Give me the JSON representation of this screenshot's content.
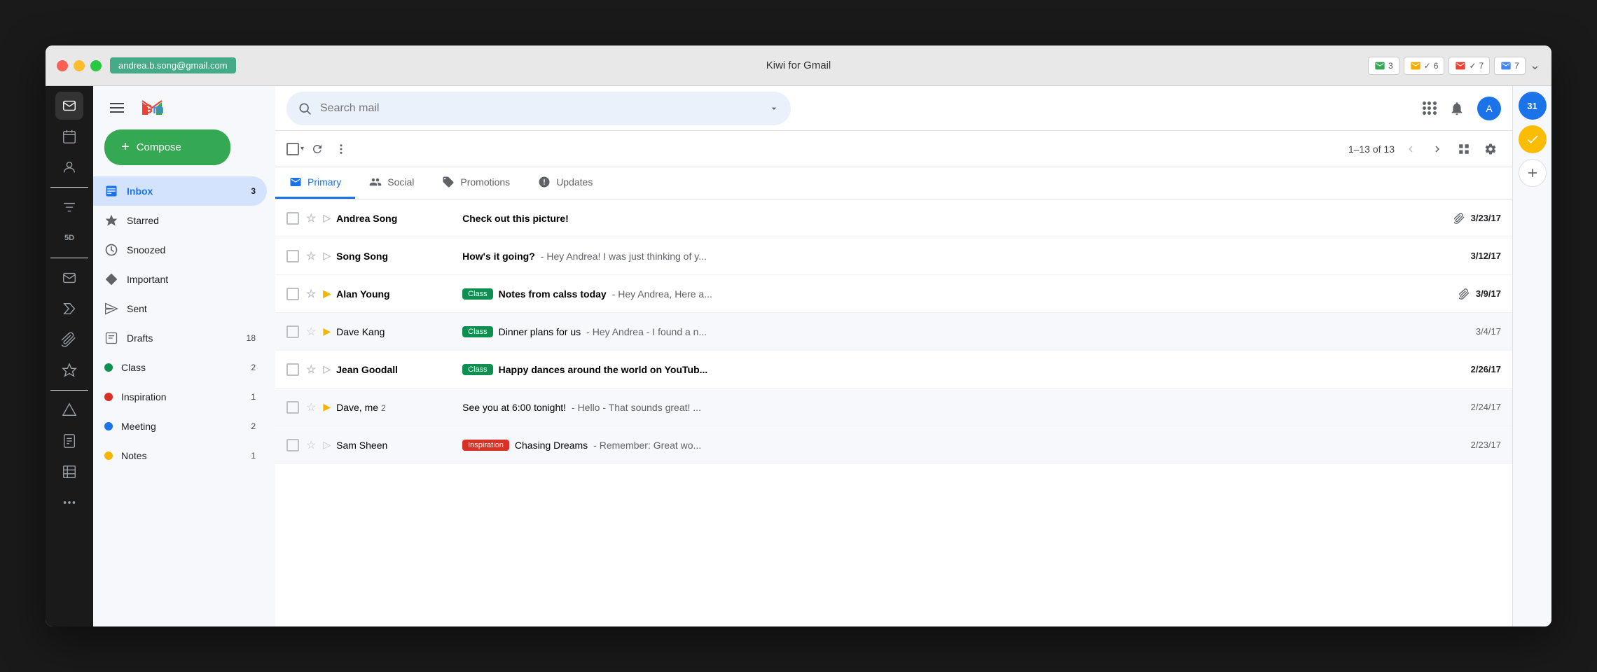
{
  "window": {
    "title": "Kiwi for Gmail",
    "account_email": "andrea.b.song@gmail.com"
  },
  "titlebar": {
    "notifications": [
      {
        "icon": "mail",
        "count": "3",
        "checked": false
      },
      {
        "icon": "mail",
        "count": "6",
        "checked": true
      },
      {
        "icon": "mail-red",
        "count": "7",
        "checked": false
      }
    ]
  },
  "header": {
    "search_placeholder": "Search mail",
    "gmail_logo": "Gmail"
  },
  "toolbar": {
    "counter": "1–13 of 13"
  },
  "tabs": [
    {
      "id": "primary",
      "label": "Primary",
      "active": true
    },
    {
      "id": "social",
      "label": "Social",
      "active": false
    },
    {
      "id": "promotions",
      "label": "Promotions",
      "active": false
    },
    {
      "id": "updates",
      "label": "Updates",
      "active": false
    }
  ],
  "sidebar": {
    "compose_label": "Compose",
    "items": [
      {
        "id": "inbox",
        "label": "Inbox",
        "count": 3,
        "icon": "inbox",
        "active": true
      },
      {
        "id": "starred",
        "label": "Starred",
        "count": null,
        "icon": "star"
      },
      {
        "id": "snoozed",
        "label": "Snoozed",
        "count": null,
        "icon": "clock"
      },
      {
        "id": "important",
        "label": "Important",
        "count": null,
        "icon": "important"
      },
      {
        "id": "sent",
        "label": "Sent",
        "count": null,
        "icon": "sent"
      },
      {
        "id": "drafts",
        "label": "Drafts",
        "count": 18,
        "icon": "draft"
      },
      {
        "id": "class",
        "label": "Class",
        "count": 2,
        "icon": "label",
        "color": "#0d904f"
      },
      {
        "id": "inspiration",
        "label": "Inspiration",
        "count": 1,
        "icon": "label",
        "color": "#d93025"
      },
      {
        "id": "meeting",
        "label": "Meeting",
        "count": 2,
        "icon": "label",
        "color": "#1a73e8"
      },
      {
        "id": "notes",
        "label": "Notes",
        "count": 1,
        "icon": "label",
        "color": "#f4b400"
      }
    ]
  },
  "emails": [
    {
      "id": 1,
      "sender": "Andrea Song",
      "subject": "Check out this picture!",
      "preview": "",
      "date": "3/23/17",
      "unread": true,
      "starred": false,
      "forwarded": false,
      "has_attachment": true,
      "tag": null
    },
    {
      "id": 2,
      "sender": "Song Song",
      "subject": "How's it going?",
      "preview": "- Hey Andrea! I was just thinking of y...",
      "date": "3/12/17",
      "unread": true,
      "starred": false,
      "forwarded": false,
      "has_attachment": false,
      "tag": null
    },
    {
      "id": 3,
      "sender": "Alan Young",
      "subject": "Notes from calss today",
      "preview": "- Hey Andrea, Here a...",
      "date": "3/9/17",
      "unread": true,
      "starred": false,
      "forwarded": true,
      "has_attachment": true,
      "tag": "Class"
    },
    {
      "id": 4,
      "sender": "Dave Kang",
      "subject": "Dinner plans for us",
      "preview": "- Hey Andrea - I found a n...",
      "date": "3/4/17",
      "unread": false,
      "starred": false,
      "forwarded": true,
      "has_attachment": false,
      "tag": "Class"
    },
    {
      "id": 5,
      "sender": "Jean Goodall",
      "subject": "Happy dances around the world on YouTub...",
      "preview": "",
      "date": "2/26/17",
      "unread": true,
      "starred": false,
      "forwarded": false,
      "has_attachment": false,
      "tag": "Class"
    },
    {
      "id": 6,
      "sender": "Dave, me",
      "sender_count": 2,
      "subject": "See you at 6:00 tonight!",
      "preview": "- Hello - That sounds great! ...",
      "date": "2/24/17",
      "unread": false,
      "starred": false,
      "forwarded": true,
      "has_attachment": false,
      "tag": null
    },
    {
      "id": 7,
      "sender": "Sam Sheen",
      "subject": "Chasing Dreams",
      "preview": "- Remember: Great wo...",
      "date": "2/23/17",
      "unread": false,
      "starred": false,
      "forwarded": false,
      "has_attachment": false,
      "tag": "Inspiration"
    }
  ],
  "right_panel": {
    "calendar_label": "31",
    "tasks_label": "tasks",
    "add_label": "add"
  },
  "app_sidebar": {
    "icons": [
      {
        "id": "gmail",
        "label": "Gmail"
      },
      {
        "id": "calendar",
        "label": "Calendar"
      },
      {
        "id": "contacts",
        "label": "Contacts"
      },
      {
        "id": "filter",
        "label": "Filter"
      },
      {
        "id": "5d",
        "label": "5D"
      },
      {
        "id": "mail2",
        "label": "Mail 2"
      },
      {
        "id": "label-icon",
        "label": "Labels"
      },
      {
        "id": "attachment",
        "label": "Attachment"
      },
      {
        "id": "starred-app",
        "label": "Starred App"
      },
      {
        "id": "drive",
        "label": "Drive"
      },
      {
        "id": "doc",
        "label": "Doc"
      },
      {
        "id": "sheets",
        "label": "Sheets"
      },
      {
        "id": "more",
        "label": "More"
      }
    ]
  }
}
